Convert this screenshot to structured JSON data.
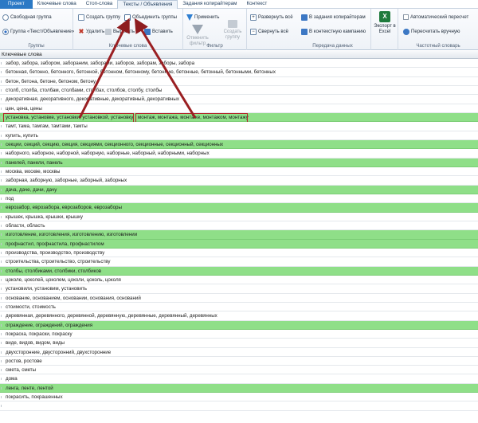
{
  "tabs": [
    {
      "label": "Проект",
      "state": "first"
    },
    {
      "label": "Ключевые слова",
      "state": "normal"
    },
    {
      "label": "Стоп-слова",
      "state": "normal"
    },
    {
      "label": "Тексты / Объявления",
      "state": "active"
    },
    {
      "label": "Задания копирайтерам",
      "state": "normal"
    },
    {
      "label": "Контекст",
      "state": "normal"
    }
  ],
  "ribbon": {
    "groups": {
      "groups_label": "Группы",
      "free_group": "Свободная группа",
      "text_group": "Группа «Текст/Объявление»",
      "keywords_label": "Ключевые слова",
      "filter_label": "Фильтр",
      "transfer_label": "Передача данных",
      "freq_label": "Частотный словарь"
    },
    "buttons": {
      "create_group": "Создать группу",
      "merge_groups": "Объединить группы",
      "delete": "Удалить",
      "cut": "Вырезать",
      "paste": "Вставить",
      "apply": "Применить",
      "cancel_filter": "Отменить фильтр",
      "create_group2": "Создать группу",
      "expand_all": "Развернуть всё",
      "collapse_all": "Свернуть всё",
      "to_copywriters": "В задания копирайтерам",
      "to_campaign": "В контекстную кампанию",
      "export_excel": "Экспорт в Excel",
      "auto_recalc": "Автоматический пересчет",
      "recalc_manual": "Пересчитать вручную"
    },
    "colors": {
      "accent": "#2b79c5",
      "highlight": "#8fdf88",
      "annotation": "#b2262a"
    }
  },
  "grid": {
    "header": "Ключевые слова",
    "rows": [
      {
        "text": "забор, забора, забором, забораним, заборами, заборов, заборам, заборы, забора",
        "green": false
      },
      {
        "text": "бетонная, бетонно, бетонного, бетонной, бетонном, бетонному, бетонную, бетонные, бетонный, бетонными, бетонных",
        "green": false
      },
      {
        "text": "бетон, бетона, бетоне, бетоном, бетону",
        "green": false
      },
      {
        "text": "столб, столба, столбам, столбами, столбах, столбов, столбу, столбы",
        "green": false
      },
      {
        "text": "декоративная, декоративного, декоративные, декоративный, декоративных",
        "green": false
      },
      {
        "text": "цен, цена, цены",
        "green": false
      },
      {
        "text": "установка, установке, установки, установкой, установку",
        "text2": "монтаж, монтажа, монтаже, монтажом, монтажу",
        "green": true,
        "boxed": true
      },
      {
        "text": "тамт, тама, тамгам, тамтами, тамты",
        "green": false
      },
      {
        "text": "купить, купить",
        "green": false
      },
      {
        "text": "секции, секций, секцию, секция, секциями, секционного, секционные, секционный, секционных",
        "green": true
      },
      {
        "text": "наборного, наборное, наборной, наборную, наборные, наборный, наборными, наборных",
        "green": false
      },
      {
        "text": "панелей, панели, панель",
        "green": true
      },
      {
        "text": "москва, москве, москвы",
        "green": false
      },
      {
        "text": "заборная, заборную, заборные, заборный, заборных",
        "green": false
      },
      {
        "text": "дача, даче, дачи, дачу",
        "green": true
      },
      {
        "text": "под",
        "green": false
      },
      {
        "text": "еврозабор, еврозабора, еврозаборов, еврозаборы",
        "green": true
      },
      {
        "text": "крышек, крышка, крышки, крышку",
        "green": false
      },
      {
        "text": "области, область",
        "green": false
      },
      {
        "text": "изготовление, изготовления, изготовлению, изготовлении",
        "green": true
      },
      {
        "text": "профнастил, профнастила, профнастилом",
        "green": true
      },
      {
        "text": "производства, производство, производству",
        "green": false
      },
      {
        "text": "строительства, строительство, строительству",
        "green": false
      },
      {
        "text": "столбы, столбиками, столбики, столбиков",
        "green": true
      },
      {
        "text": "цоколе, цоколей, цоколем, цоколи, цоколь, цоколя",
        "green": false
      },
      {
        "text": "установили, установим, установить",
        "green": false
      },
      {
        "text": "основание, основанием, основании, основания, оснований",
        "green": false
      },
      {
        "text": "стоимости, стоимость",
        "green": false
      },
      {
        "text": "деревянная, деревянного, деревянной, деревянную, деревянные, деревянный, деревянных",
        "green": false
      },
      {
        "text": "ограждение, ограждений, ограждения",
        "green": true
      },
      {
        "text": "покраска, покраски, покраску",
        "green": false
      },
      {
        "text": "виде, видов, видом, виды",
        "green": false
      },
      {
        "text": "двухсторонние, двусторонний, двухсторонние",
        "green": false
      },
      {
        "text": "ростов, ростове",
        "green": false
      },
      {
        "text": "смета, сметы",
        "green": false
      },
      {
        "text": "дома",
        "green": false
      },
      {
        "text": "ленга, ленте, лентой",
        "green": true
      },
      {
        "text": "покрасить, покрашенных",
        "green": false
      },
      {
        "text": "",
        "green": false
      }
    ]
  }
}
